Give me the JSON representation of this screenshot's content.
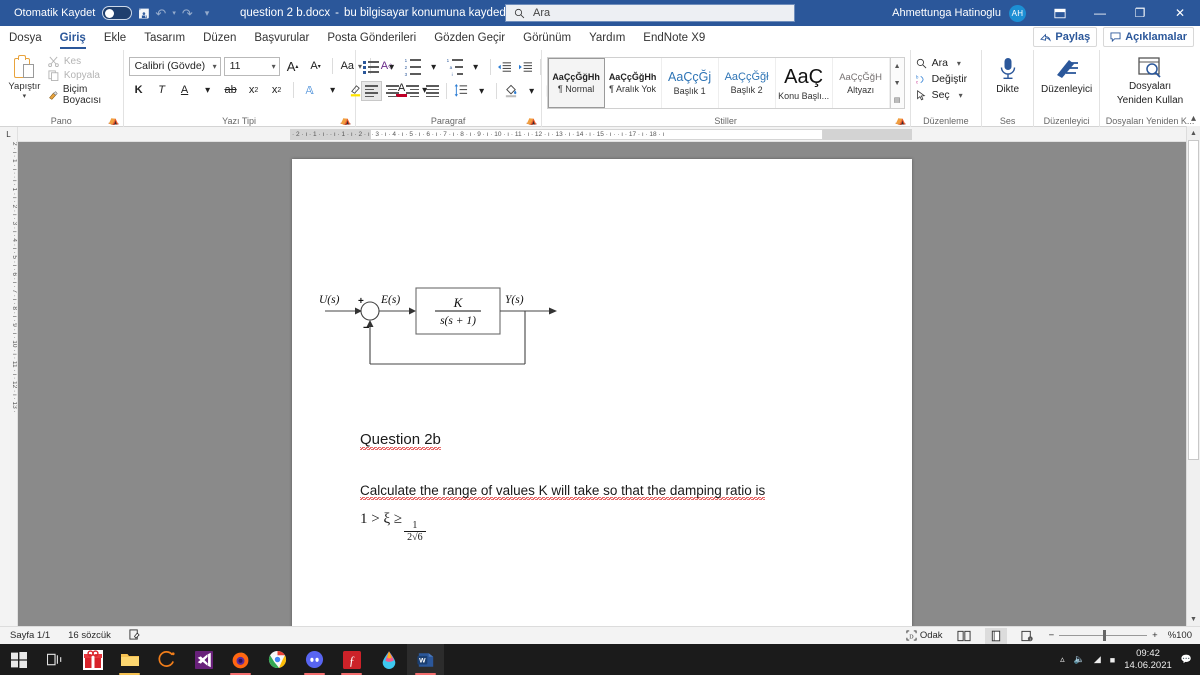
{
  "titlebar": {
    "autosave_label": "Otomatik Kaydet",
    "autosave_state": "off",
    "save_icon": "save-icon",
    "undo_icon": "undo-icon",
    "redo_icon": "redo-icon",
    "customize_icon": "customize-quick-access-icon",
    "document_title": "question 2 b.docx",
    "document_status": "bu bilgisayar konumuna kaydedildi",
    "title_dropdown": "▾",
    "search_placeholder": "Ara",
    "search_icon": "search-icon",
    "user_name": "Ahmettunga Hatinoglu",
    "user_initials": "AH",
    "ribbon_display_icon": "ribbon-display-options-icon",
    "minimize": "—",
    "maximize": "❐",
    "close": "✕"
  },
  "tabs": [
    {
      "label": "Dosya",
      "active": false
    },
    {
      "label": "Giriş",
      "active": true
    },
    {
      "label": "Ekle",
      "active": false
    },
    {
      "label": "Tasarım",
      "active": false
    },
    {
      "label": "Düzen",
      "active": false
    },
    {
      "label": "Başvurular",
      "active": false
    },
    {
      "label": "Posta Gönderileri",
      "active": false
    },
    {
      "label": "Gözden Geçir",
      "active": false
    },
    {
      "label": "Görünüm",
      "active": false
    },
    {
      "label": "Yardım",
      "active": false
    },
    {
      "label": "EndNote X9",
      "active": false
    }
  ],
  "tab_actions": {
    "share_label": "Paylaş",
    "comments_label": "Açıklamalar"
  },
  "ribbon": {
    "clipboard": {
      "group_label": "Pano",
      "paste_label": "Yapıştır",
      "cut_label": "Kes",
      "copy_label": "Kopyala",
      "format_painter_label": "Biçim Boyacısı"
    },
    "font": {
      "group_label": "Yazı Tipi",
      "font_name": "Calibri (Gövde)",
      "font_size": "11",
      "grow_font": "A",
      "shrink_font": "A",
      "change_case": "Aa",
      "clear_formatting": "A",
      "bold": "K",
      "italic": "T",
      "underline": "A",
      "strikethrough": "ab",
      "subscript": "x",
      "superscript": "x",
      "text_effects": "A",
      "highlight": "ab",
      "font_color": "A"
    },
    "paragraph": {
      "group_label": "Paragraf",
      "bullets": "bullets-icon",
      "numbering": "numbering-icon",
      "multilevel": "multilevel-list-icon",
      "decrease_indent": "decrease-indent-icon",
      "increase_indent": "increase-indent-icon",
      "sort": "sort-icon",
      "show_marks": "¶",
      "align_left": "align-left-icon",
      "align_center": "align-center-icon",
      "align_right": "align-right-icon",
      "justify": "justify-icon",
      "line_spacing": "line-spacing-icon",
      "shading": "shading-icon",
      "borders": "borders-icon"
    },
    "styles": {
      "group_label": "Stiller",
      "items": [
        {
          "preview": "AaÇçĞğHh",
          "name": "¶ Normal",
          "selected": true
        },
        {
          "preview": "AaÇçĞğHh",
          "name": "¶ Aralık Yok",
          "selected": false
        },
        {
          "preview": "AaÇçĞj",
          "name": "Başlık 1",
          "selected": false
        },
        {
          "preview": "AaÇçĞğł",
          "name": "Başlık 2",
          "selected": false
        },
        {
          "preview": "AaÇ",
          "name": "Konu Başlı...",
          "selected": false
        },
        {
          "preview": "AaÇçĞğH",
          "name": "Altyazı",
          "selected": false
        }
      ]
    },
    "editing": {
      "group_label": "Düzenleme",
      "find_label": "Ara",
      "replace_label": "Değiştir",
      "select_label": "Seç"
    },
    "voice": {
      "group_label": "Ses",
      "dictate_label": "Dikte"
    },
    "editor": {
      "group_label": "Düzenleyici",
      "editor_label": "Düzenleyici"
    },
    "reuse": {
      "group_label": "Dosyaları Yeniden K...",
      "reuse_label_line1": "Dosyaları",
      "reuse_label_line2": "Yeniden Kullan"
    },
    "collapse_icon": "collapse-ribbon-icon"
  },
  "rulers": {
    "tab_selector": "L",
    "horizontal_ticks": "·  2  ·  ı  ·  1  ·  ı  ·        ·  ı  ·  1  ·  ı  ·  2  ·  ı  ·  3  ·  ı  ·  4  ·  ı  ·  5  ·  ı  ·  6  ·  ı  ·  7  ·  ı  ·  8  ·  ı  ·  9  ·  ı  · 10  ·  ı  · 11  ·  ı  · 12  ·  ı  · 13  ·  ı  · 14  ·  ı  · 15  ·  ı  ·        ·  ı  · 17  ·  ı  · 18  ·  ı",
    "vertical_ticks": "2 · ı · 1 · ı ·     · ı · 1 · ı · 2 · ı · 3 · ı · 4 · ı · 5 · ı · 6 · ı · 7 · ı · 8 · ı · 9 · ı · 10 · ı · 11 · ı · 12 · ı · 13 ·"
  },
  "document": {
    "diagram": {
      "name": "feedback-control-block-diagram",
      "input_label": "U(s)",
      "plus_sign": "+",
      "minus_sign": "−",
      "error_label": "E(s)",
      "transfer_numerator": "K",
      "transfer_denominator": "s(s + 1)",
      "output_label": "Y(s)"
    },
    "heading": "Question 2b",
    "paragraph": "Calculate the range of values K will take so that the damping ratio is",
    "formula": {
      "lhs": "1 > ξ ≥",
      "frac_num": "1",
      "frac_den": "2√6"
    }
  },
  "statusbar": {
    "page_info": "Sayfa 1/1",
    "word_count": "16 sözcük",
    "proofing_icon": "proofing-status-icon",
    "focus_label": "Odak",
    "read_mode_icon": "read-mode-icon",
    "print_layout_icon": "print-layout-icon",
    "web_layout_icon": "web-layout-icon",
    "zoom_out": "−",
    "zoom_in": "+",
    "zoom_level": "%100"
  },
  "taskbar": {
    "items": [
      {
        "name": "start-button",
        "icon": "windows-logo"
      },
      {
        "name": "task-view-button",
        "icon": "task-view"
      },
      {
        "name": "taskbar-item-gift",
        "icon": "gift-app"
      },
      {
        "name": "taskbar-item-file-explorer",
        "icon": "folder"
      },
      {
        "name": "taskbar-item-maya",
        "icon": "orange-ring"
      },
      {
        "name": "taskbar-item-visual-studio",
        "icon": "visual-studio"
      },
      {
        "name": "taskbar-item-firefox",
        "icon": "firefox"
      },
      {
        "name": "taskbar-item-chrome",
        "icon": "chrome"
      },
      {
        "name": "taskbar-item-discord",
        "icon": "discord"
      },
      {
        "name": "taskbar-item-acrobat",
        "icon": "adobe-acrobat"
      },
      {
        "name": "taskbar-item-paint3d",
        "icon": "color-drop"
      },
      {
        "name": "taskbar-item-word",
        "icon": "word",
        "active": true
      }
    ],
    "tray": {
      "volume_icon": "volume-icon",
      "wifi_icon": "wifi-icon",
      "battery_icon": "battery-icon",
      "time": "09:42",
      "date": "14.06.2021",
      "notifications_icon": "notifications-icon"
    }
  },
  "colors": {
    "word_blue": "#2b579a",
    "accent_orange": "#e8a33d",
    "heading_blue": "#2e74b5",
    "spell_error_red": "#e03b3b"
  }
}
